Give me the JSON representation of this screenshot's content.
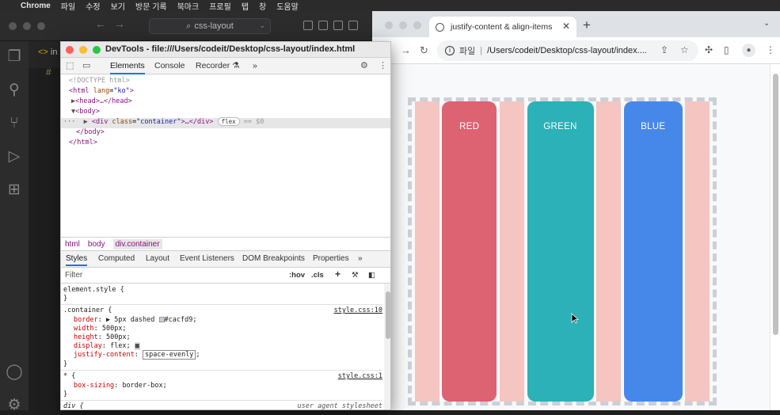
{
  "menubar": {
    "items": [
      "Chrome",
      "파일",
      "수정",
      "보기",
      "방문 기록",
      "북마크",
      "프로필",
      "탭",
      "창",
      "도움말"
    ]
  },
  "vscode": {
    "search_text": "css-layout",
    "tab_label": "in",
    "code_fragment": "#"
  },
  "chrome": {
    "tab_title": "justify-content & align-items",
    "omnibox_scheme": "파일",
    "omnibox_path": "/Users/codeit/Desktop/css-layout/index...."
  },
  "page": {
    "items": [
      {
        "label": "RED",
        "color": "#dd6272"
      },
      {
        "label": "GREEN",
        "color": "#2bb1b7"
      },
      {
        "label": "BLUE",
        "color": "#4688ea"
      }
    ],
    "spacer_color": "#f5c5c1",
    "border_color": "#cacfd9"
  },
  "devtools": {
    "title": "DevTools - file:///Users/codeit/Desktop/css-layout/index.html",
    "tabs": [
      "Elements",
      "Console",
      "Recorder",
      "»"
    ],
    "dom": {
      "doctype": "<!DOCTYPE html>",
      "html_open_tag": "<html",
      "html_lang_attr": "lang",
      "html_lang_val": "\"ko\"",
      "head": "<head>…</head>",
      "body_open": "<body>",
      "div_tag": "<div",
      "div_class_attr": "class",
      "div_class_val": "\"container\"",
      "div_close": ">…</div>",
      "flex_badge": "flex",
      "eq": "== $0",
      "body_close": "</body>",
      "html_close": "</html>"
    },
    "breadcrumbs": [
      "html",
      "body",
      "div.container"
    ],
    "subtabs": [
      "Styles",
      "Computed",
      "Layout",
      "Event Listeners",
      "DOM Breakpoints",
      "Properties",
      "»"
    ],
    "filter_placeholder": "Filter",
    "hov": ":hov",
    "cls": ".cls",
    "styles": {
      "element_style": "element.style {",
      "close": "}",
      "container_selector": ".container {",
      "container_src": "style.css:10",
      "border_prop": "border",
      "border_val": "5px dashed",
      "border_color": "#cacfd9;",
      "width_prop": "width",
      "width_val": "500px;",
      "height_prop": "height",
      "height_val": "500px;",
      "display_prop": "display",
      "display_val": "flex;",
      "jc_prop": "justify-content",
      "jc_val": "space-evenly",
      "star_selector": "* {",
      "star_src": "style.css:1",
      "bs_prop": "box-sizing",
      "bs_val": "border-box;",
      "div_selector": "div {",
      "div_src": "user agent stylesheet"
    }
  }
}
